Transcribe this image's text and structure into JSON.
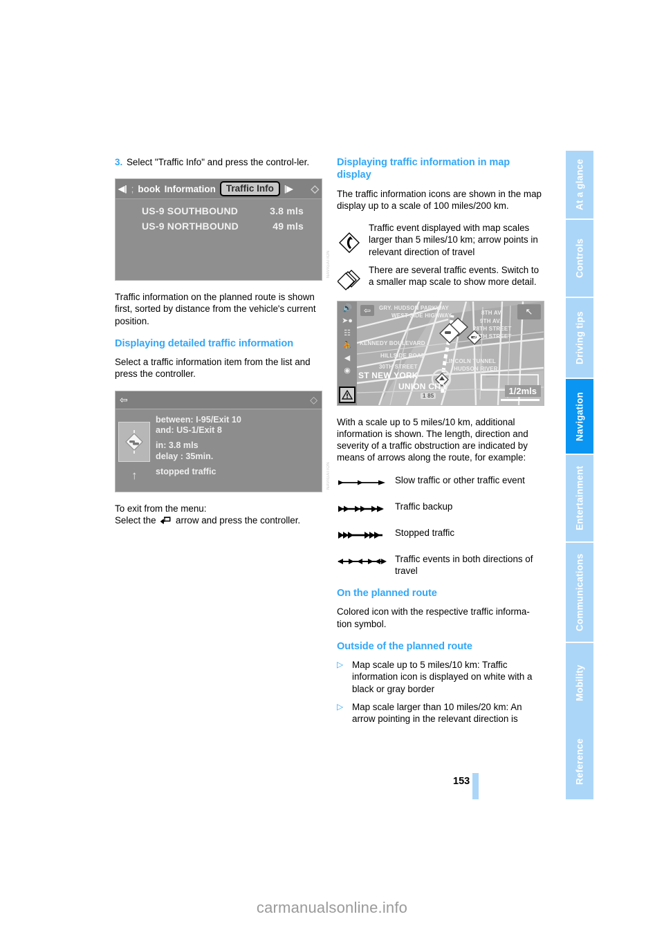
{
  "document": {
    "page_number": "153",
    "watermark": "carmanualsonline.info"
  },
  "tabs": [
    {
      "label": "At a glance",
      "active": false
    },
    {
      "label": "Controls",
      "active": false
    },
    {
      "label": "Driving tips",
      "active": false
    },
    {
      "label": "Navigation",
      "active": true
    },
    {
      "label": "Entertainment",
      "active": false
    },
    {
      "label": "Communications",
      "active": false
    },
    {
      "label": "Mobility",
      "active": false
    },
    {
      "label": "Reference",
      "active": false
    }
  ],
  "colors": {
    "accent_blue": "#33a7f5",
    "tab_active": "#0a95f2",
    "tab_inactive": "#abd6f8"
  },
  "left_column": {
    "step": {
      "number": "3.",
      "text": "Select \"Traffic Info\" and press the control-ler."
    },
    "screenshot_traffic_list": {
      "menu_back_icon": "left-arrow-icon",
      "separator": ";",
      "crumb_book": "book",
      "crumb_information": "Information",
      "selected_item": "Traffic Info",
      "menu_forward_icon": "right-arrow-icon",
      "spinner_icon": "controller-icon",
      "rows": [
        {
          "name": "US-9 SOUTHBOUND",
          "distance": "3.8 mls"
        },
        {
          "name": "US-9 NORTHBOUND",
          "distance": "49 mls"
        }
      ]
    },
    "paragraph_1": "Traffic information on the planned route is shown first, sorted by distance from the vehicle's current position.",
    "heading_detailed": "Displaying detailed traffic information",
    "paragraph_2": "Select a traffic information item from the list and press the controller.",
    "screenshot_detail": {
      "back_icon": "return-arrow-icon",
      "spinner_icon": "controller-icon",
      "between_label": "between: I-95/Exit 10",
      "and_label": "and: US-1/Exit 8",
      "distance_label": "in: 3.8 mls",
      "delay_label": "delay : 35min.",
      "status_label": "stopped traffic",
      "event_icon": "traffic-jam-diamond-icon",
      "direction_icon": "up-arrow-icon"
    },
    "exit_intro": "To exit from the menu:",
    "exit_line_pre": "Select the",
    "exit_line_post": "arrow and press the controller.",
    "exit_icon": "return-arrow-icon"
  },
  "right_column": {
    "heading_map_display": "Displaying traffic information in map display",
    "paragraph_1": "The traffic information icons are shown in the map display up to a scale of 100 miles/200 km.",
    "legend_icons": [
      {
        "icon": "traffic-event-diamond-icon",
        "text": "Traffic event displayed with map scales larger than 5 miles/10 km; arrow points in relevant direction of travel"
      },
      {
        "icon": "stacked-diamond-icon",
        "text": "There are several traffic events. Switch to a smaller map scale to show more detail."
      }
    ],
    "screenshot_map": {
      "sidebar_icons": [
        "speaker-icon",
        "route-arrow-icon",
        "split-screen-icon",
        "pedestrian-icon",
        "navigation-arrow-icon",
        "compass-settings-icon"
      ],
      "warning_icon": "warning-triangle-icon",
      "back_icon": "return-arrow-icon",
      "compass_icon": "north-arrow-icon",
      "scale": "1/2mls",
      "street_labels": [
        "GRY. HUDSON PARKWAY",
        "WEST SIDE HIGHWAY",
        "8TH AV.",
        "9TH AV.",
        "28TH STREET",
        "30TH STREET",
        "KENNEDY BOULEVARD",
        "HILLSIDE ROAD",
        "30TH STREET",
        "LINCOLN TUNNEL",
        "HUDSON RIVER",
        "ST NEW YORK",
        "UNION CITY"
      ],
      "route_shield": "1 85"
    },
    "paragraph_2": "With a scale up to 5 miles/10 km, additional information is shown. The length, direction and severity of a traffic obstruction are indicated by means of arrows along the route, for example:",
    "arrow_legend": [
      {
        "symbol": "single-arrow-line-icon",
        "text": "Slow traffic or other traffic event"
      },
      {
        "symbol": "double-arrow-line-icon",
        "text": "Traffic backup"
      },
      {
        "symbol": "triple-arrow-line-icon",
        "text": "Stopped traffic"
      },
      {
        "symbol": "bidirectional-arrow-line-icon",
        "text": "Traffic events in both directions of travel"
      }
    ],
    "heading_on_route": "On the planned route",
    "paragraph_on_route": "Colored icon with the respective traffic informa-tion symbol.",
    "heading_outside_route": "Outside of the planned route",
    "bullets": [
      "Map scale up to 5 miles/10 km: Traffic information icon is displayed on white with a black or gray border",
      "Map scale larger than 10 miles/20 km: An arrow pointing in the relevant direction is"
    ]
  }
}
